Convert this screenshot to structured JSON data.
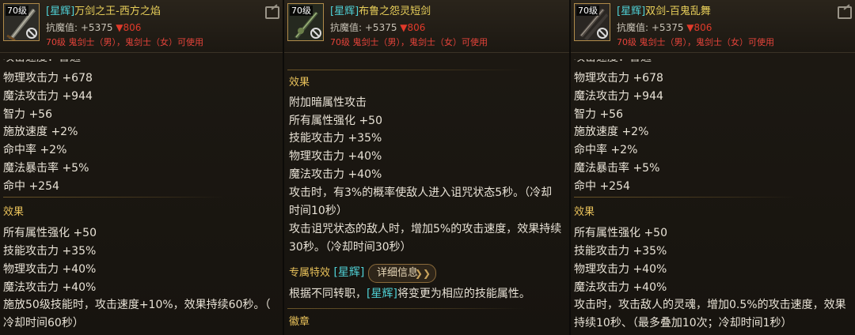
{
  "panels": [
    {
      "level_badge": "70级",
      "tag": "[星辉]",
      "name": "万剑之王-西方之焰",
      "resist_label": "抗魔值:",
      "resist_value": "+5375",
      "resist_down": "▼806",
      "requirement": "70级 鬼剑士（男），鬼剑士（女）可使用",
      "cut_text": "攻击速度：普通",
      "stats": [
        "物理攻击力 +678",
        "魔法攻击力 +944",
        "智力 +56",
        "施放速度 +2%",
        "命中率 +2%",
        "魔法暴击率 +5%",
        "命中 +254"
      ],
      "effect_title": "效果",
      "effects": [
        "所有属性强化 +50",
        "技能攻击力 +35%",
        "物理攻击力 +40%",
        "魔法攻击力 +40%",
        "施放50级技能时，攻击速度+10%，效果持续60秒。（",
        "冷却时间60秒）"
      ]
    },
    {
      "level_badge": "70级",
      "tag": "[星辉]",
      "name": "布鲁之怨灵短剑",
      "resist_label": "抗魔值:",
      "resist_value": "+5375",
      "resist_down": "▼806",
      "requirement": "70级 鬼剑士（男），鬼剑士（女）可使用",
      "effect_title": "效果",
      "effects": [
        "附加暗属性攻击",
        "所有属性强化 +50",
        "技能攻击力 +35%",
        "物理攻击力 +40%",
        "魔法攻击力 +40%",
        "攻击时，有3%的概率使敌人进入诅咒状态5秒。（冷却",
        "时间10秒）",
        "攻击诅咒状态的敌人时，增加5%的攻击速度，效果持续",
        "30秒。（冷却时间30秒）"
      ],
      "exclusive_title": "专属特效",
      "exclusive_tag": "[星辉]",
      "detail_button": "详细信息",
      "detail_arrow": "❯❯",
      "note_prefix": "根据不同转职，",
      "note_tag": "[星辉]",
      "note_suffix": "将变更为相应的技能属性。",
      "badge_title": "徽章"
    },
    {
      "level_badge": "70级",
      "tag": "[星辉]",
      "name": "双剑-百鬼乱舞",
      "resist_label": "抗魔值:",
      "resist_value": "+5375",
      "resist_down": "▼806",
      "requirement": "70级 鬼剑士（男），鬼剑士（女）可使用",
      "cut_text": "攻击速度：普通",
      "stats": [
        "物理攻击力 +678",
        "魔法攻击力 +944",
        "智力 +56",
        "施放速度 +2%",
        "命中率 +2%",
        "魔法暴击率 +5%",
        "命中 +254"
      ],
      "effect_title": "效果",
      "effects": [
        "所有属性强化 +50",
        "技能攻击力 +35%",
        "物理攻击力 +40%",
        "魔法攻击力 +40%",
        "攻击时，攻击敌人的灵魂，增加0.5%的攻击速度，效果",
        "持续10秒、（最多叠加10次；冷却时间1秒）"
      ]
    }
  ]
}
